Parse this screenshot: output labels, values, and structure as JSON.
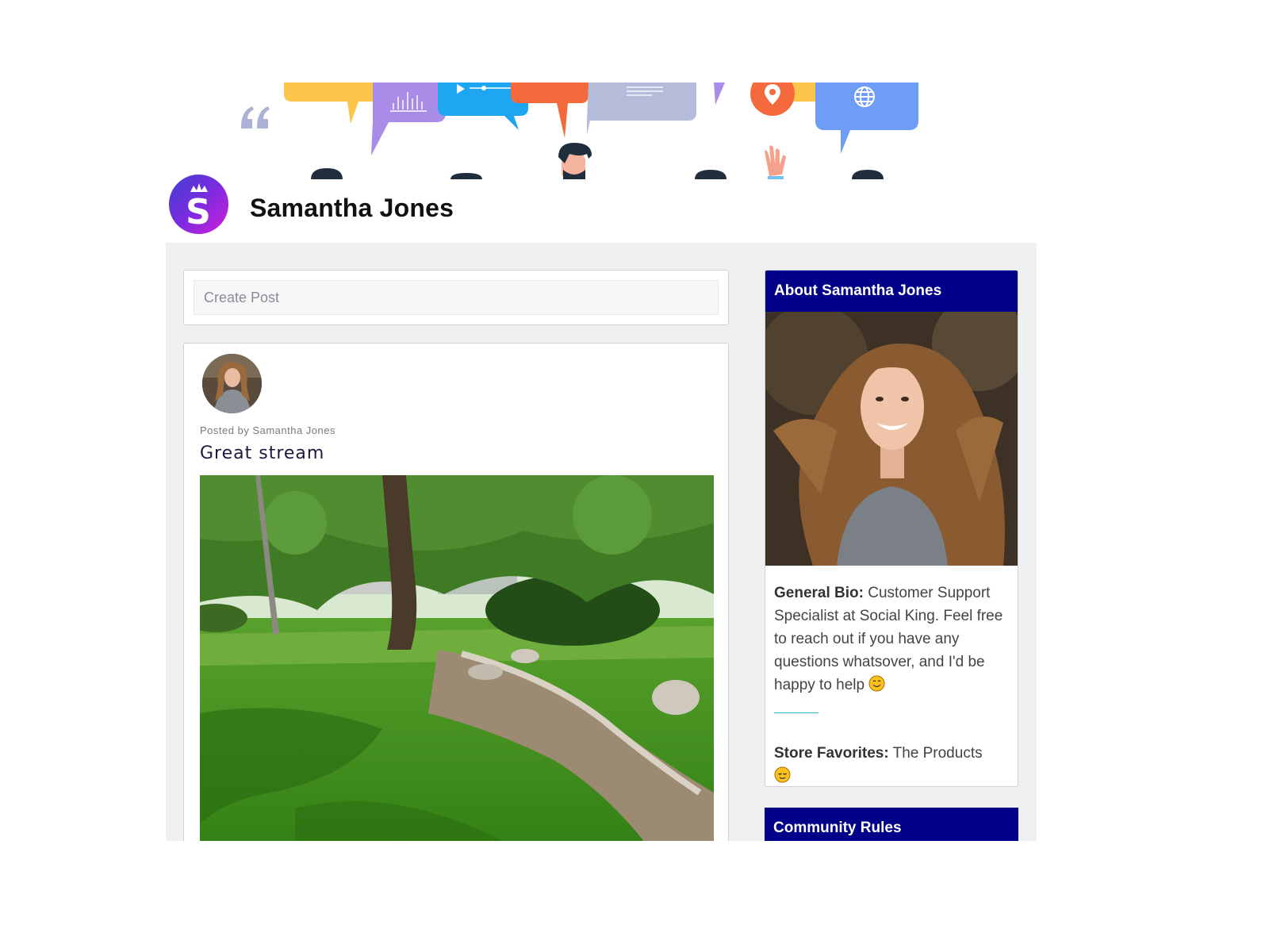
{
  "profile": {
    "name": "Samantha Jones",
    "logo_letter": "S"
  },
  "create_post": {
    "placeholder": "Create Post"
  },
  "post": {
    "meta": "Posted by Samantha Jones",
    "title": "Great stream"
  },
  "about": {
    "header": "About Samantha Jones",
    "bio_label": "General Bio:",
    "bio_text": "Customer Support Specialist at Social King. Feel free to reach out if you have any questions whatsover, and I'd be happy to help",
    "bio_emoji": "smiling-face-icon",
    "favorites_label": "Store Favorites:",
    "favorites_text": "The Products",
    "favorites_emoji": "relieved-face-icon"
  },
  "rules": {
    "header": "Community Rules"
  },
  "colors": {
    "sidebar_header": "#000088",
    "content_bg": "#eef0f1",
    "divider": "#3ab7cc",
    "logo_gradient": [
      "#3f3fd1",
      "#d21fd8"
    ]
  }
}
